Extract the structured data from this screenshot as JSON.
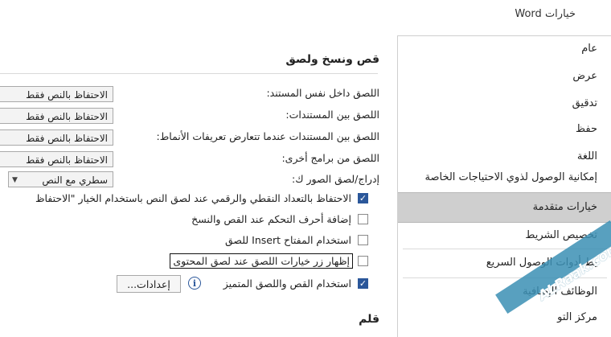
{
  "window": {
    "title": "خيارات Word"
  },
  "nav": {
    "items": [
      {
        "label": "عام"
      },
      {
        "label": "عرض"
      },
      {
        "label": "تدقيق"
      },
      {
        "label": "حفظ"
      },
      {
        "label": "اللغة"
      },
      {
        "label": "إمكانية الوصول لذوي الاحتياجات الخاصة"
      },
      {
        "label": "خيارات متقدمة"
      },
      {
        "label": "تخصيص الشريط"
      },
      {
        "label": "يط أدوات الوصول السريع"
      },
      {
        "label": "الوظائف الإضافية"
      },
      {
        "label": "مركز التو"
      }
    ],
    "selected": "خيارات متقدمة"
  },
  "section": {
    "title": "قص ونسخ ولصق",
    "next_title": "قلم"
  },
  "paste_options": [
    {
      "label": "اللصق داخل نفس المستند:",
      "value": "الاحتفاظ بالنص فقط"
    },
    {
      "label": "اللصق بين المستندات:",
      "value": "الاحتفاظ بالنص فقط"
    },
    {
      "label": "اللصق بين المستندات عندما تتعارض تعريفات الأنماط:",
      "value": "الاحتفاظ بالنص فقط"
    },
    {
      "label": "اللصق من برامج أخرى:",
      "value": "الاحتفاظ بالنص فقط"
    }
  ],
  "insert_images": {
    "label": "إدراج/لصق الصور ك:",
    "value": "سطري مع النص"
  },
  "checkboxes": [
    {
      "label": "الاحتفاظ بالتعداد النقطي والرقمي عند لصق النص باستخدام الخيار \"الاحتفاظ",
      "checked": true
    },
    {
      "label": "إضافة أحرف التحكم عند القص والنسخ",
      "checked": false
    },
    {
      "label": "استخدام المفتاح Insert للصق",
      "checked": false
    },
    {
      "label": "إظهار زر خيارات اللصق عند لصق المحتوى",
      "checked": false
    },
    {
      "label": "استخدام القص واللصق المتميز",
      "checked": true
    }
  ],
  "settings_button": {
    "label": "إعدادات..."
  },
  "watermark": {
    "text": "ALRaak.com"
  },
  "colors": {
    "accent": "#2b579a",
    "selected_nav": "#cfcfcf"
  }
}
